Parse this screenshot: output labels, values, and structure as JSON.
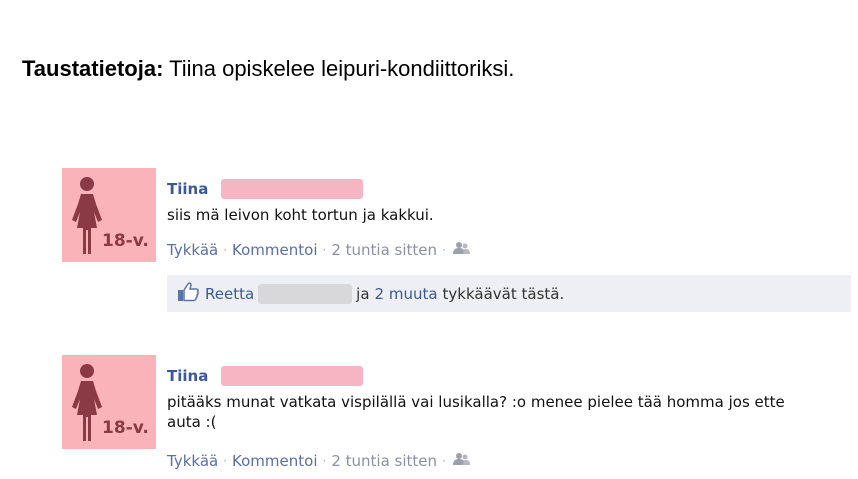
{
  "background": {
    "label": "Taustatietoja:",
    "text": "Tiina opiskelee leipuri-kondiittoriksi."
  },
  "colors": {
    "avatar_bg": "#fab3b8",
    "name_link": "#3b5998",
    "meta_gray": "#8b91a3",
    "likes_bg": "#edeff4",
    "redaction_pink": "#f6b5c3",
    "redaction_gray": "#d8d8da"
  },
  "posts": [
    {
      "author": "Tiina",
      "avatar_age": "18-v.",
      "text": "siis mä leivon koht tortun ja kakkui.",
      "like_label": "Tykkää",
      "comment_label": "Kommentoi",
      "time": "2 tuntia sitten",
      "privacy_icon": "friends-icon",
      "likes": {
        "icon": "thumbs-up-icon",
        "liker": "Reetta",
        "joiner": "ja",
        "others": "2 muuta",
        "suffix": "tykkäävät tästä."
      }
    },
    {
      "author": "Tiina",
      "avatar_age": "18-v.",
      "text": "pitääks munat vatkata vispilällä vai lusikalla? :o menee pielee tää homma jos ette auta :(",
      "like_label": "Tykkää",
      "comment_label": "Kommentoi",
      "time": "2 tuntia sitten",
      "privacy_icon": "friends-icon"
    }
  ]
}
